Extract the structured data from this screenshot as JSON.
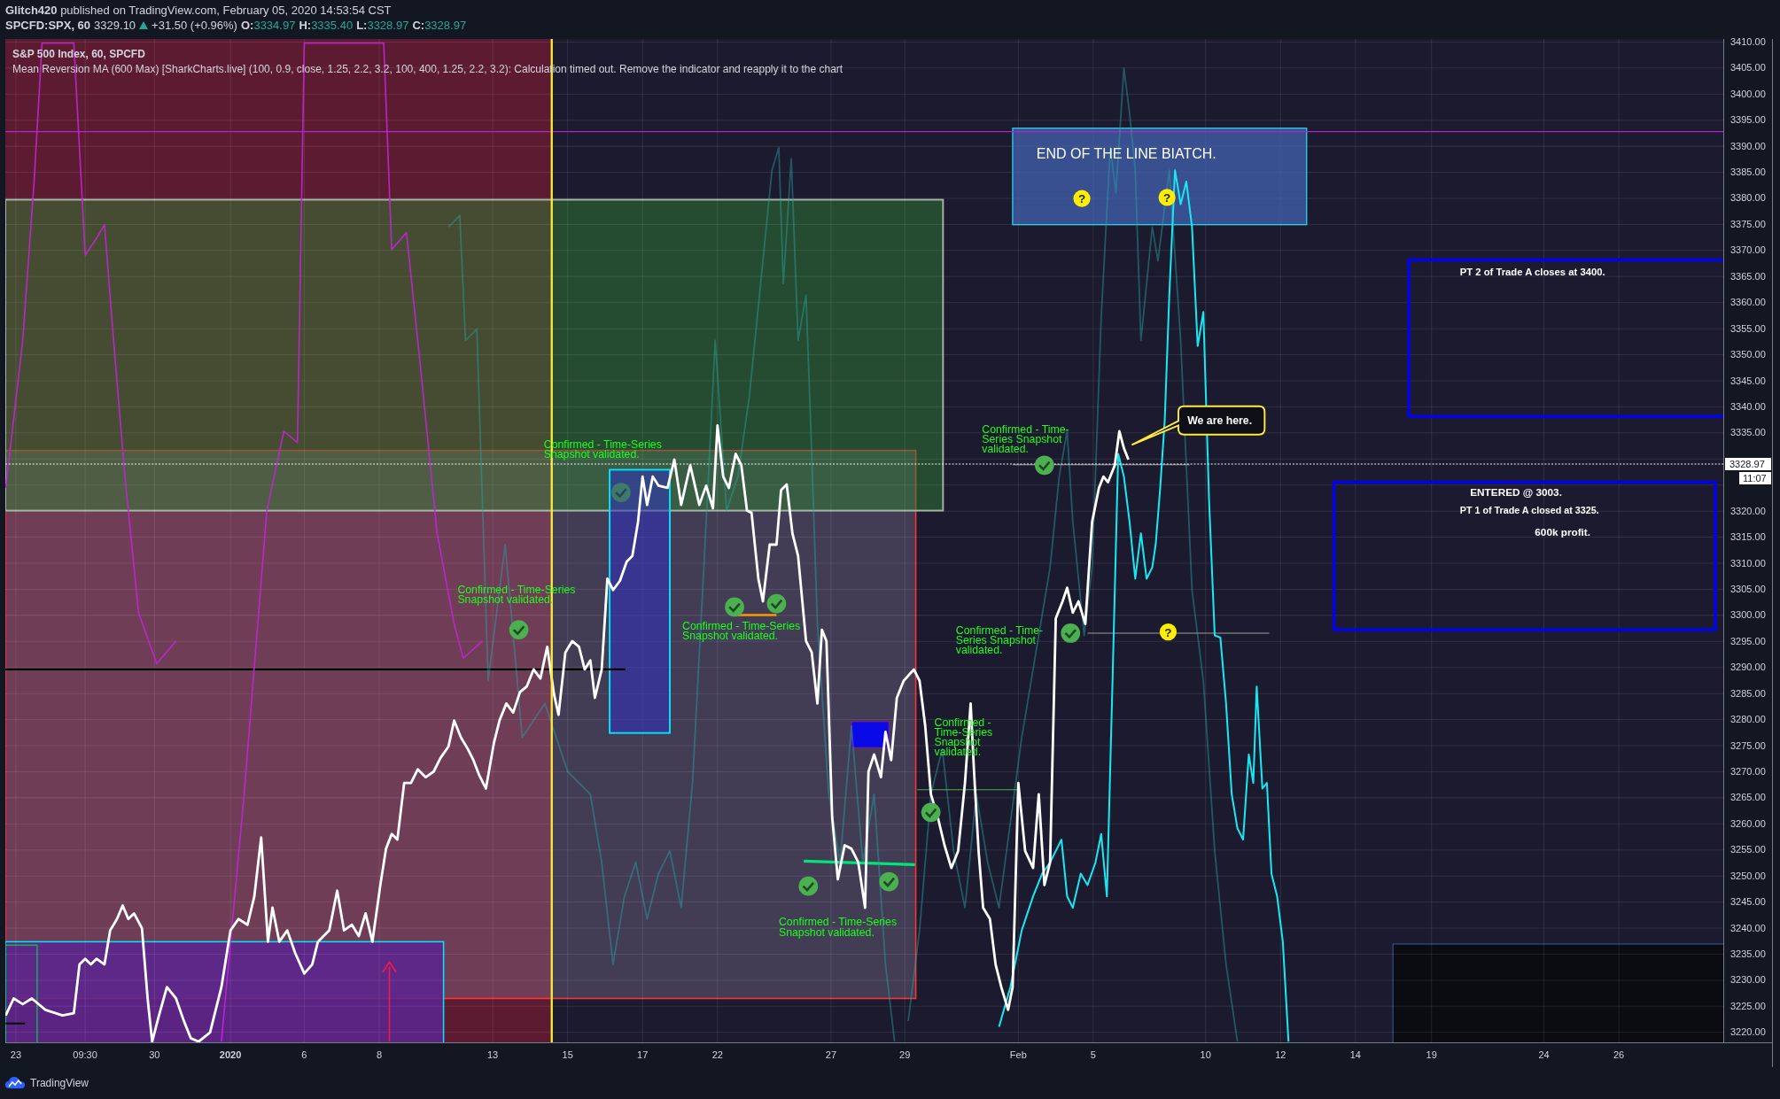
{
  "header": {
    "byline": "**Glitch420** published on TradingView.com, February 05, 2020 14:53:54 CST",
    "symbol": "SPCFD:SPX, 60",
    "last": "3329.10",
    "change": "+31.50 (+0.96%)",
    "ohlc": [
      {
        "label": "O:",
        "value": "3334.97"
      },
      {
        "label": "H:",
        "value": "3335.40"
      },
      {
        "label": "L:",
        "value": "3328.97"
      },
      {
        "label": "C:",
        "value": "3328.97"
      }
    ]
  },
  "legend": {
    "title": "S&P 500 Index, 60, SPCFD",
    "indicator": "Mean Reversion MA (600 Max) [SharkCharts.live] (100, 0.9, close, 1.25, 2.2, 3.2, 100, 400, 1.25, 2.2, 3.2): Calculation timed out. Remove the indicator and reapply it to the chart"
  },
  "annotations": [
    {
      "lines": [
        "Confirmed - Time-Series",
        "Snapshot validated."
      ]
    },
    {
      "lines": [
        "Confirmed - Time-Series",
        "Snapshot validated."
      ]
    },
    {
      "lines": [
        "Confirmed - Time-Series",
        "Snapshot validated."
      ]
    },
    {
      "lines": [
        "Confirmed - Time-Series",
        "Snapshot validated."
      ]
    },
    {
      "lines": [
        "Confirmed - Time-",
        "Series Snapshot",
        "validated."
      ]
    },
    {
      "lines": [
        "Confirmed - Time-",
        "Series Snapshot",
        "validated."
      ]
    },
    {
      "lines": [
        "Confirmed -",
        "Time-Series",
        "Snapshot",
        "validated."
      ]
    }
  ],
  "end_box": {
    "text": "END OF THE LINE BIATCH."
  },
  "help_markers": [
    "?",
    "?",
    "?"
  ],
  "callout": {
    "text": "We are here."
  },
  "target_box": {
    "text": "PT 2 of Trade A closes at 3400."
  },
  "entry_box": {
    "lines": [
      "ENTERED @ 3003.",
      "PT 1 of Trade A closed at 3325.",
      "600k profit."
    ]
  },
  "price_axis": {
    "labels": [
      "3410.00",
      "3405.00",
      "3400.00",
      "3395.00",
      "3390.00",
      "3385.00",
      "3380.00",
      "3375.00",
      "3370.00",
      "3365.00",
      "3360.00",
      "3355.00",
      "3350.00",
      "3345.00",
      "3340.00",
      "3335.00",
      "3320.00",
      "3315.00",
      "3310.00",
      "3305.00",
      "3300.00",
      "3295.00",
      "3290.00",
      "3285.00",
      "3280.00",
      "3275.00",
      "3270.00",
      "3265.00",
      "3260.00",
      "3255.00",
      "3250.00",
      "3245.00",
      "3240.00",
      "3235.00",
      "3230.00",
      "3225.00",
      "3220.00"
    ],
    "last_price": "3328.97",
    "countdown": "11:07"
  },
  "time_axis": {
    "labels": [
      {
        "text": "23",
        "bold": false
      },
      {
        "text": "09:30",
        "bold": false
      },
      {
        "text": "30",
        "bold": false
      },
      {
        "text": "2020",
        "bold": true
      },
      {
        "text": "6",
        "bold": false
      },
      {
        "text": "8",
        "bold": false
      },
      {
        "text": "13",
        "bold": false
      },
      {
        "text": "15",
        "bold": false
      },
      {
        "text": "17",
        "bold": false
      },
      {
        "text": "22",
        "bold": false
      },
      {
        "text": "27",
        "bold": false
      },
      {
        "text": "29",
        "bold": false
      },
      {
        "text": "Feb",
        "bold": false
      },
      {
        "text": "5",
        "bold": false
      },
      {
        "text": "10",
        "bold": false
      },
      {
        "text": "12",
        "bold": false
      },
      {
        "text": "14",
        "bold": false
      },
      {
        "text": "19",
        "bold": false
      },
      {
        "text": "24",
        "bold": false
      },
      {
        "text": "26",
        "bold": false
      }
    ]
  },
  "footer": {
    "brand": "TradingView"
  }
}
